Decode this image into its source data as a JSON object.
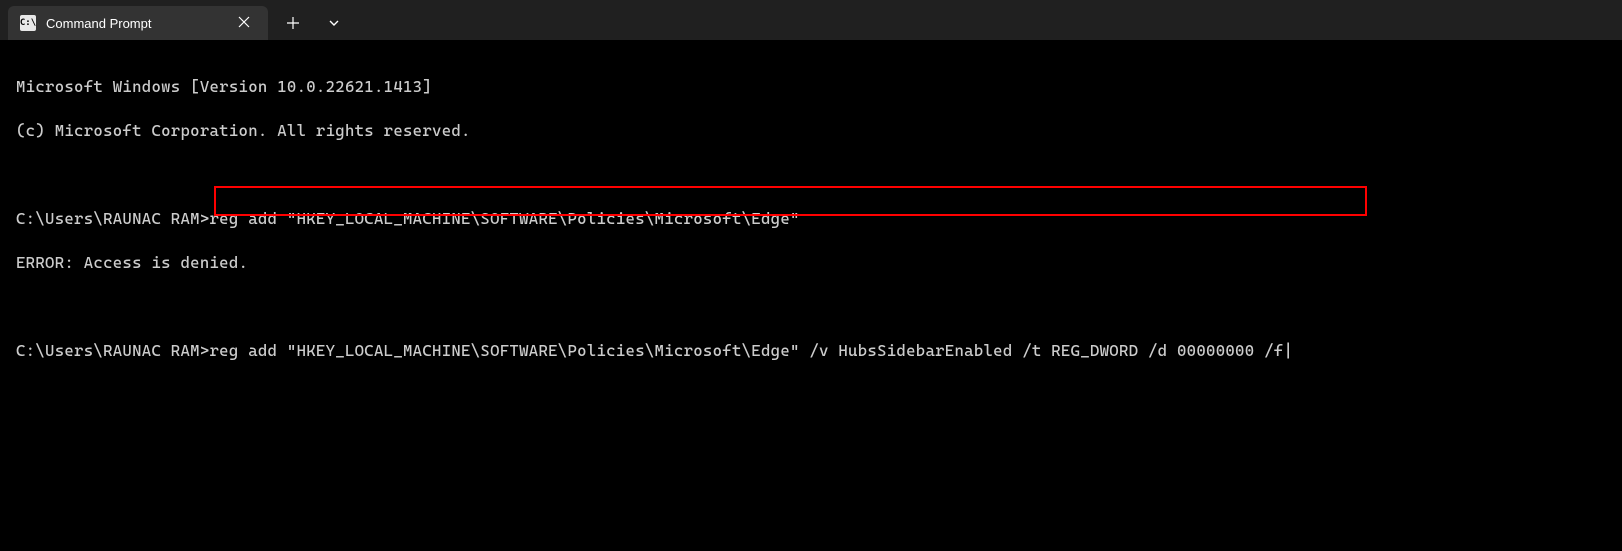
{
  "titlebar": {
    "tab_title": "Command Prompt",
    "tab_icon_text": "C:\\"
  },
  "terminal": {
    "lines": {
      "l1": "Microsoft Windows [Version 10.0.22621.1413]",
      "l2": "(c) Microsoft Corporation. All rights reserved.",
      "l3": "",
      "l4_prompt": "C:\\Users\\RAUNAC RAM>",
      "l4_cmd": "reg add \"HKEY_LOCAL_MACHINE\\SOFTWARE\\Policies\\Microsoft\\Edge\"",
      "l5": "ERROR: Access is denied.",
      "l6": "",
      "l7_prompt": "C:\\Users\\RAUNAC RAM>",
      "l7_cmd": "reg add \"HKEY_LOCAL_MACHINE\\SOFTWARE\\Policies\\Microsoft\\Edge\" /v HubsSidebarEnabled /t REG_DWORD /d 00000000 /f"
    }
  }
}
